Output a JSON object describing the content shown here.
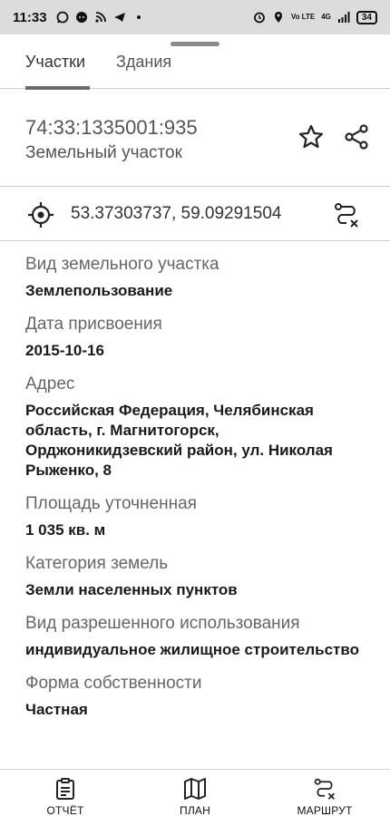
{
  "status_bar": {
    "time": "11:33",
    "network_small": "Vo LTE",
    "network_top": "4G",
    "battery": "34"
  },
  "tabs": [
    {
      "label": "Участки"
    },
    {
      "label": "Здания"
    }
  ],
  "parcel": {
    "cadastral_number": "74:33:1335001:935",
    "type": "Земельный участок"
  },
  "coordinates": "53.37303737, 59.09291504",
  "details": [
    {
      "label": "Вид земельного участка",
      "value": "Землепользование"
    },
    {
      "label": "Дата присвоения",
      "value": "2015-10-16"
    },
    {
      "label": "Адрес",
      "value": "Российская Федерация, Челябинская область, г. Магнитогорск, Орджоникидзевский район, ул. Николая Рыженко, 8"
    },
    {
      "label": "Площадь уточненная",
      "value": "1 035 кв. м"
    },
    {
      "label": "Категория земель",
      "value": "Земли населенных пунктов"
    },
    {
      "label": "Вид разрешенного использования",
      "value": "индивидуальное жилищное строительство"
    },
    {
      "label": "Форма собственности",
      "value": "Частная"
    }
  ],
  "bottom_nav": [
    {
      "label": "ОТЧЁТ",
      "icon": "report-icon"
    },
    {
      "label": "ПЛАН",
      "icon": "map-icon"
    },
    {
      "label": "МАРШРУТ",
      "icon": "route-icon"
    }
  ]
}
